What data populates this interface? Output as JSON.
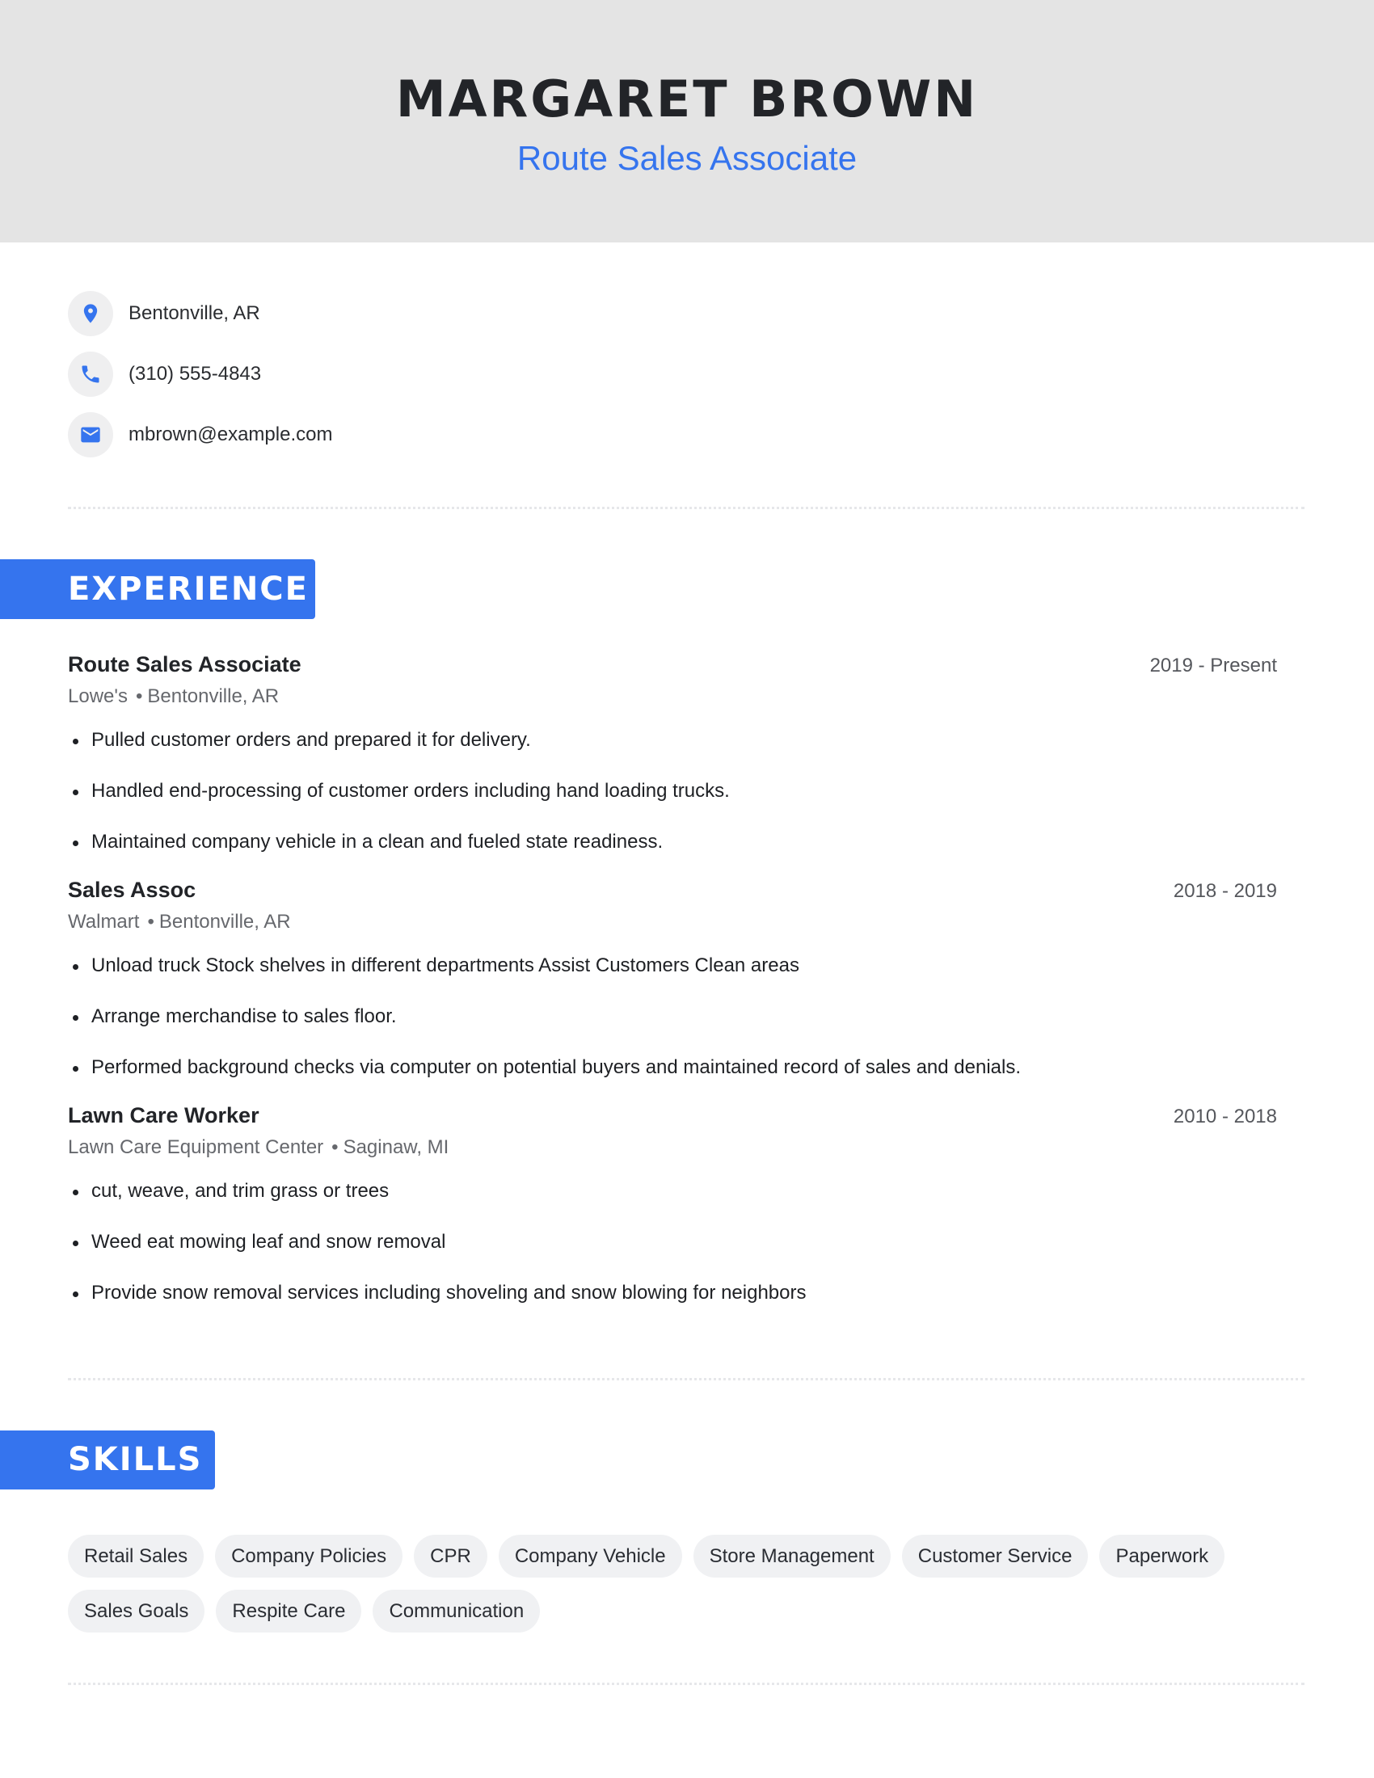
{
  "header": {
    "name": "MARGARET BROWN",
    "role": "Route Sales Associate"
  },
  "contact": [
    {
      "icon": "location-pin-icon",
      "text": "Bentonville, AR"
    },
    {
      "icon": "phone-icon",
      "text": "(310) 555-4843"
    },
    {
      "icon": "email-icon",
      "text": "mbrown@example.com"
    }
  ],
  "colors": {
    "accent": "#3574ee",
    "header_bg": "#e4e4e4",
    "chip_bg": "#f0f1f3",
    "text": "#222428"
  },
  "experience": {
    "heading": "EXPERIENCE",
    "jobs": [
      {
        "title": "Route Sales Associate",
        "company": "Lowe's",
        "location": "Bentonville, AR",
        "dates": "2019 - Present",
        "bullets": [
          "Pulled customer orders and prepared it for delivery.",
          "Handled end-processing of customer orders including hand loading trucks.",
          "Maintained company vehicle in a clean and fueled state readiness."
        ]
      },
      {
        "title": "Sales Assoc",
        "company": "Walmart",
        "location": "Bentonville, AR",
        "dates": "2018 - 2019",
        "bullets": [
          "Unload truck Stock shelves in different departments Assist Customers Clean areas",
          "Arrange merchandise to sales floor.",
          "Performed background checks via computer on potential buyers and maintained record of sales and denials."
        ]
      },
      {
        "title": "Lawn Care Worker",
        "company": "Lawn Care Equipment Center",
        "location": "Saginaw, MI",
        "dates": "2010 - 2018",
        "bullets": [
          "cut, weave, and trim grass or trees",
          "Weed eat mowing leaf and snow removal",
          "Provide snow removal services including shoveling and snow blowing for neighbors"
        ]
      }
    ]
  },
  "skills": {
    "heading": "SKILLS",
    "items": [
      "Retail Sales",
      "Company Policies",
      "CPR",
      "Company Vehicle",
      "Store Management",
      "Customer Service",
      "Paperwork",
      "Sales Goals",
      "Respite Care",
      "Communication"
    ]
  }
}
